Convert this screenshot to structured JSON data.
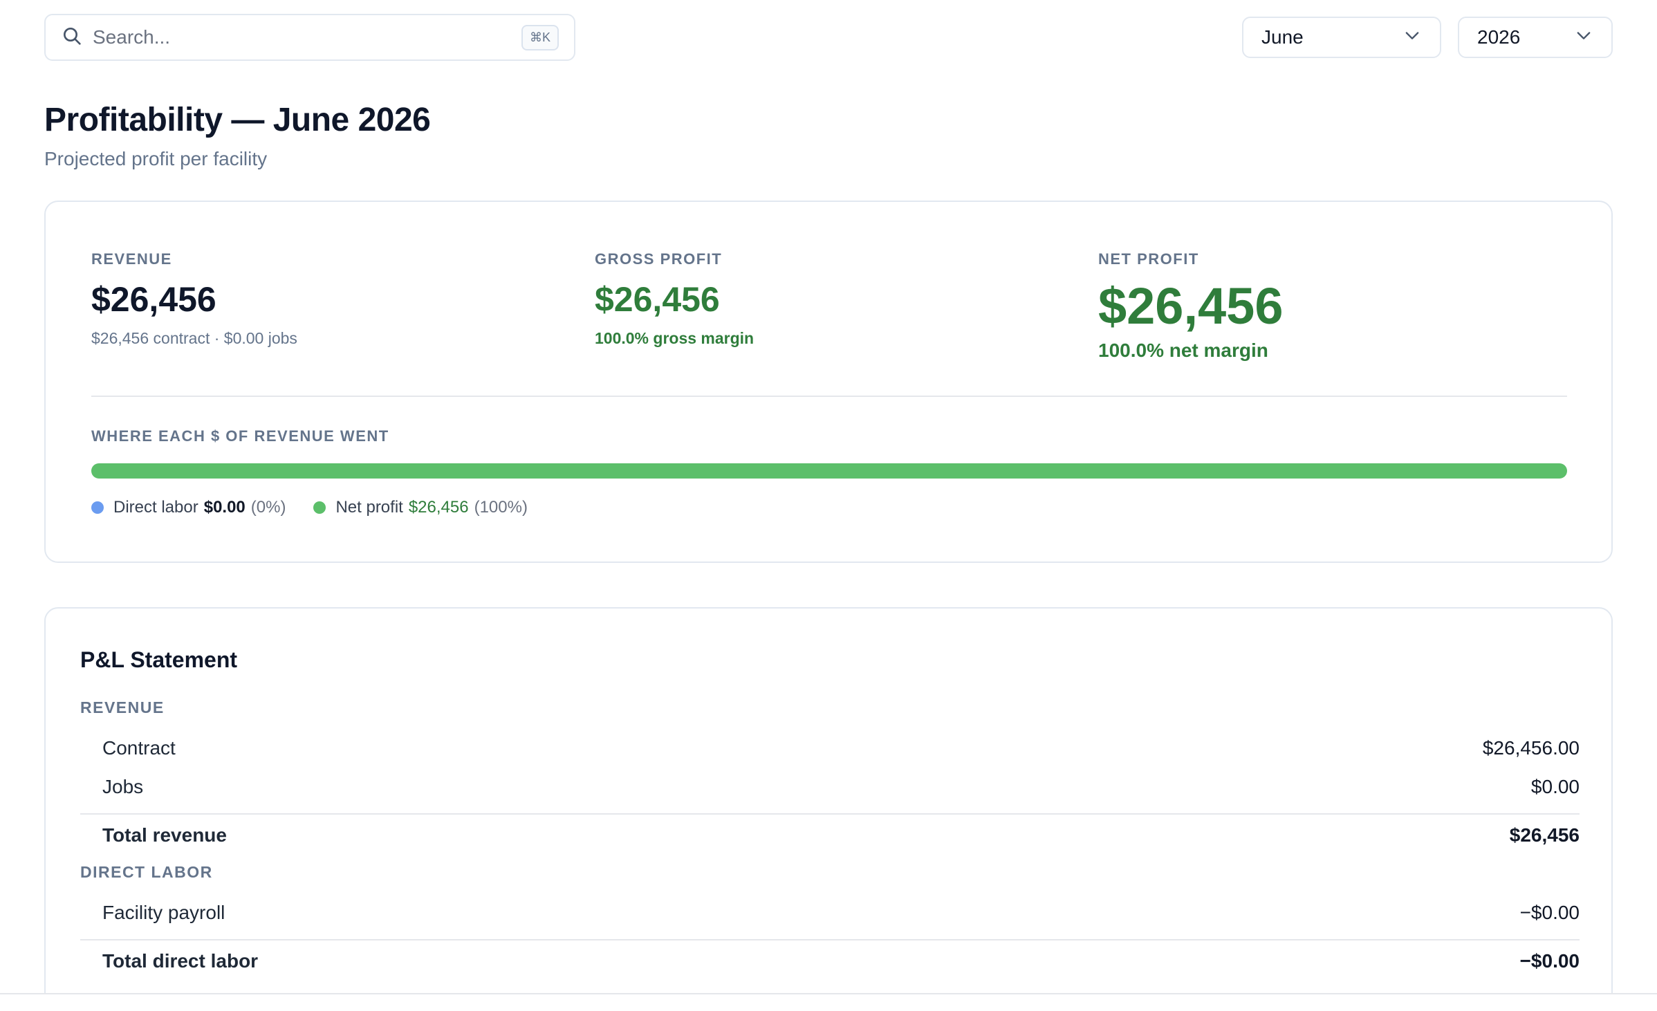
{
  "search": {
    "placeholder": "Search...",
    "shortcut": "⌘K",
    "icon": "search-icon"
  },
  "filters": {
    "month": "June",
    "year": "2026",
    "icon": "chevron-down-icon"
  },
  "header": {
    "title": "Profitability — June 2026",
    "subtitle": "Projected profit per facility"
  },
  "summary": {
    "revenue": {
      "label": "REVENUE",
      "value": "$26,456",
      "detail": "$26,456 contract · $0.00 jobs"
    },
    "gross_profit": {
      "label": "GROSS PROFIT",
      "value": "$26,456",
      "detail": "100.0% gross margin"
    },
    "net_profit": {
      "label": "NET PROFIT",
      "value": "$26,456",
      "detail": "100.0% net margin"
    },
    "breakdown": {
      "label": "WHERE EACH $ OF REVENUE WENT",
      "segments": [
        {
          "name": "Direct labor",
          "amount": "$0.00",
          "pct": "(0%)",
          "fraction": 0,
          "color": "#6b9cf0"
        },
        {
          "name": "Net profit",
          "amount": "$26,456",
          "pct": "(100%)",
          "fraction": 1,
          "color": "#5cbf6a"
        }
      ]
    }
  },
  "pl": {
    "title": "P&L Statement",
    "revenue_section": "REVENUE",
    "contract": {
      "label": "Contract",
      "amount": "$26,456.00"
    },
    "jobs": {
      "label": "Jobs",
      "amount": "$0.00"
    },
    "total_revenue": {
      "label": "Total revenue",
      "amount": "$26,456"
    },
    "labor_section": "DIRECT LABOR",
    "payroll": {
      "label": "Facility payroll",
      "amount": "−$0.00"
    },
    "total_labor": {
      "label": "Total direct labor",
      "amount": "−$0.00"
    }
  },
  "colors": {
    "accent_green": "#2f7d3b",
    "bar_green": "#5cbf6a",
    "bar_blue": "#6b9cf0"
  }
}
